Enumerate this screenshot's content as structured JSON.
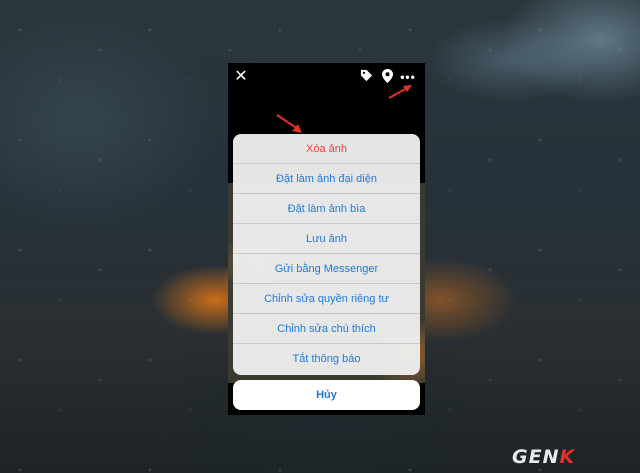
{
  "topbar": {
    "icons": [
      "close-icon",
      "tag-icon",
      "location-pin-icon",
      "more-icon"
    ]
  },
  "action_sheet": {
    "items": [
      {
        "label": "Xóa ảnh",
        "color": "#f03e3e"
      },
      {
        "label": "Đặt làm ảnh đại diện",
        "color": "#1f7ae0"
      },
      {
        "label": "Đặt làm ảnh bìa",
        "color": "#1f7ae0"
      },
      {
        "label": "Lưu ảnh",
        "color": "#1f7ae0"
      },
      {
        "label": "Gửi bằng Messenger",
        "color": "#1f7ae0"
      },
      {
        "label": "Chỉnh sửa quyền riêng tư",
        "color": "#1f7ae0"
      },
      {
        "label": "Chỉnh sửa chú thích",
        "color": "#1f7ae0"
      },
      {
        "label": "Tắt thông báo",
        "color": "#1f7ae0"
      }
    ],
    "cancel_label": "Hủy"
  },
  "watermark": {
    "logo": "GENK"
  },
  "colors": {
    "accent": "#1f7ae0",
    "destructive": "#f03e3e",
    "annotation_arrow": "#e4322b"
  }
}
